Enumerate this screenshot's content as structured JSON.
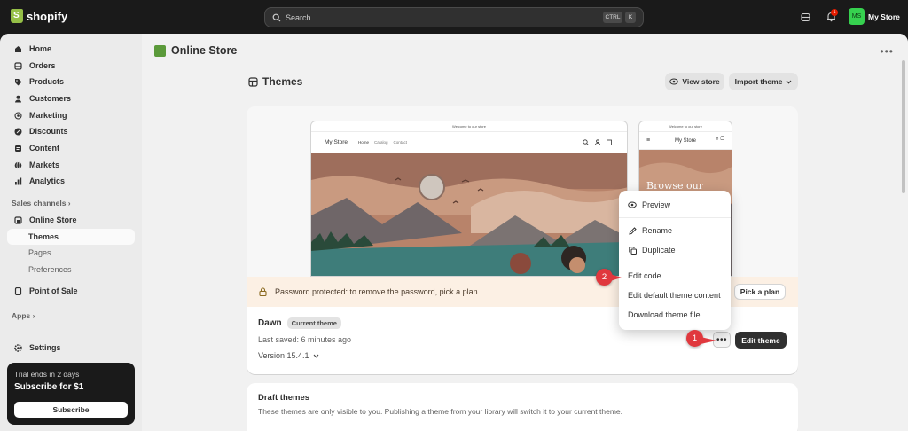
{
  "topbar": {
    "brand": "shopify",
    "search_placeholder": "Search",
    "shortcut_ctrl": "CTRL",
    "shortcut_k": "K",
    "notification_count": "1",
    "store_initials": "MS",
    "store_name": "My Store"
  },
  "sidebar": {
    "items": [
      {
        "label": "Home",
        "icon": "home-icon"
      },
      {
        "label": "Orders",
        "icon": "orders-icon"
      },
      {
        "label": "Products",
        "icon": "tag-icon"
      },
      {
        "label": "Customers",
        "icon": "person-icon"
      },
      {
        "label": "Marketing",
        "icon": "target-icon"
      },
      {
        "label": "Discounts",
        "icon": "discount-icon"
      },
      {
        "label": "Content",
        "icon": "content-icon"
      },
      {
        "label": "Markets",
        "icon": "globe-icon"
      },
      {
        "label": "Analytics",
        "icon": "chart-icon"
      }
    ],
    "sales_channels_label": "Sales channels",
    "online_store_label": "Online Store",
    "sub_items": [
      "Themes",
      "Pages",
      "Preferences"
    ],
    "pos_label": "Point of Sale",
    "apps_label": "Apps",
    "settings_label": "Settings",
    "trial": {
      "line1": "Trial ends in 2 days",
      "line2": "Subscribe for $1",
      "button": "Subscribe"
    }
  },
  "main": {
    "page_title": "Online Store",
    "section_title": "Themes",
    "view_store": "View store",
    "import_theme": "Import theme",
    "preview": {
      "announcement": "Welcome to our store",
      "store_name": "My Store",
      "nav_links": [
        "Home",
        "Catalog",
        "Contact"
      ],
      "mobile_hero": "Browse our latest"
    },
    "banner_text": "Password protected: to remove the password, pick a plan",
    "pick_plan": "Pick a plan",
    "theme_name": "Dawn",
    "current_badge": "Current theme",
    "last_saved": "Last saved: 6 minutes ago",
    "version": "Version 15.4.1",
    "edit_theme": "Edit theme",
    "more_actions": "•••",
    "menu": {
      "preview": "Preview",
      "rename": "Rename",
      "duplicate": "Duplicate",
      "edit_code": "Edit code",
      "edit_default": "Edit default theme content",
      "download": "Download theme file"
    },
    "steps": [
      "1",
      "2"
    ],
    "draft_title": "Draft themes",
    "draft_desc": "These themes are only visible to you. Publishing a theme from your library will switch it to your current theme."
  },
  "colors": {
    "topbar": "#1a1a1a",
    "accent_green": "#36d14f",
    "step_marker": "#e0383e",
    "banner_bg": "#fcf0e4"
  }
}
